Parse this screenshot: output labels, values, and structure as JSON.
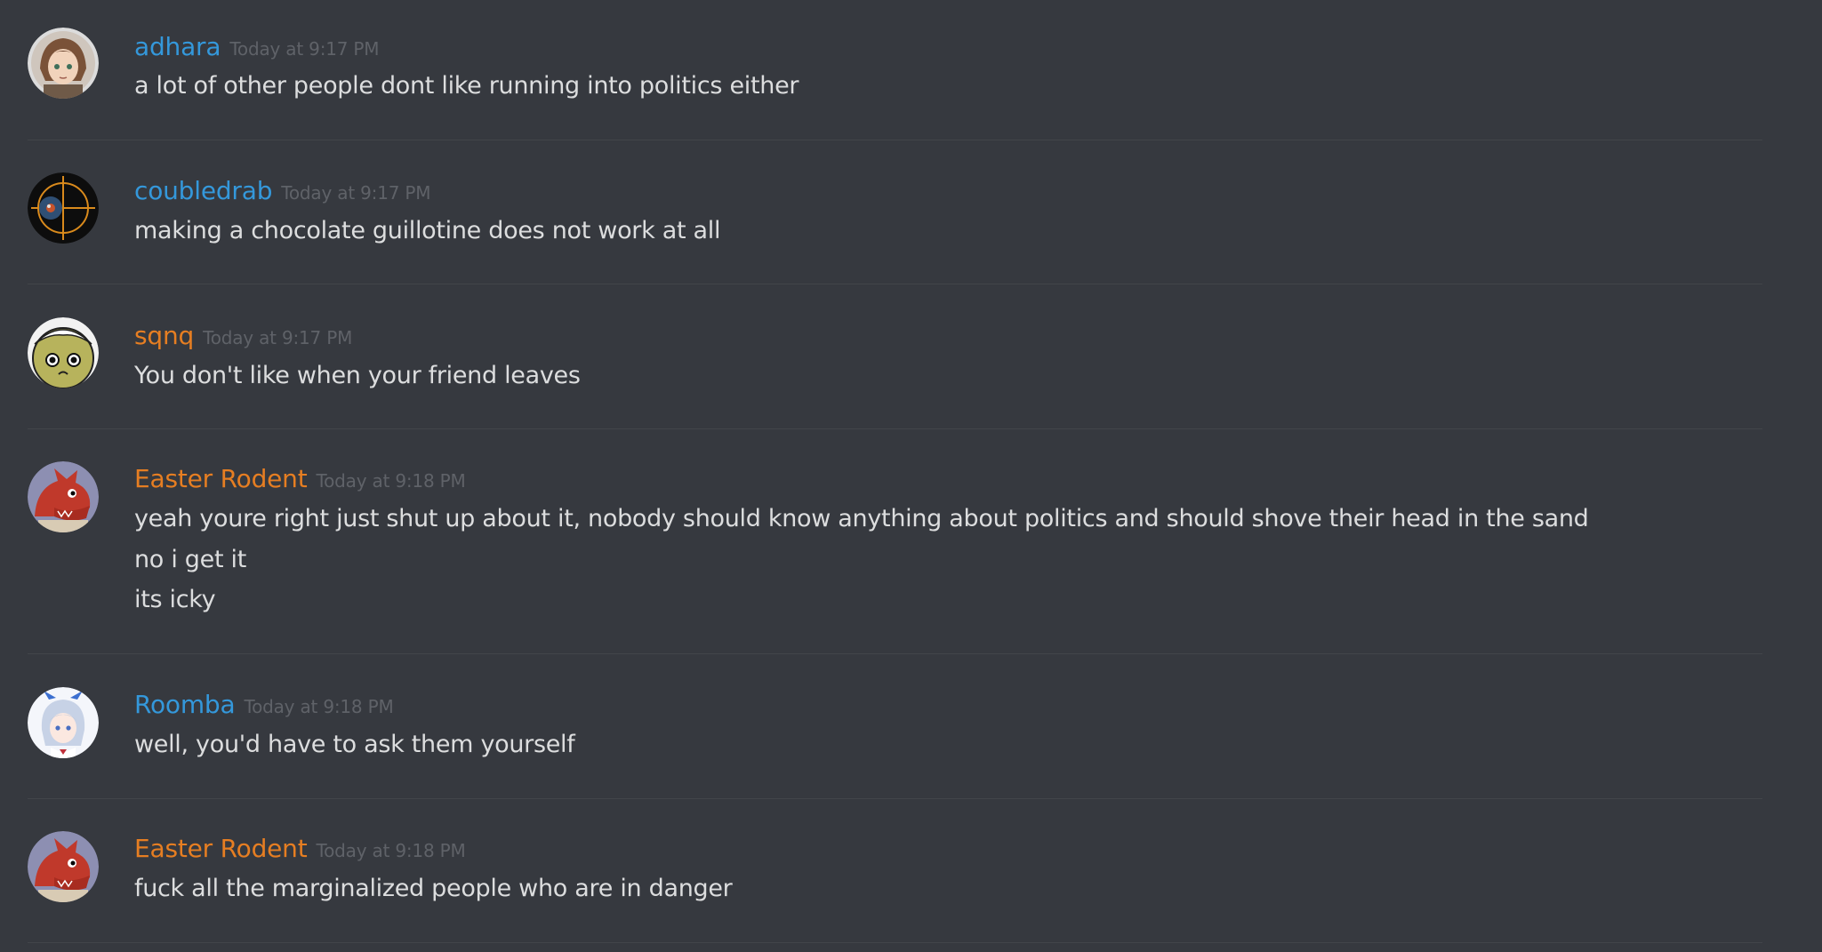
{
  "colors": {
    "background": "#36393f",
    "text": "#dcddde",
    "timestamp": "#5f6268",
    "divider": "#42454a",
    "blue_user": "#3498db",
    "orange_user": "#e67e22"
  },
  "messages": [
    {
      "username": "adhara",
      "name_color": "#3498db",
      "avatar_icon": "anime-girl-brown-hair-avatar",
      "timestamp": "Today at 9:17 PM",
      "lines": [
        "a lot of other people dont like running into politics either"
      ]
    },
    {
      "username": "coubledrab",
      "name_color": "#3498db",
      "avatar_icon": "orange-crosshair-orb-avatar",
      "timestamp": "Today at 9:17 PM",
      "lines": [
        "making a chocolate guillotine does not work at all"
      ]
    },
    {
      "username": "sqnq",
      "name_color": "#e67e22",
      "avatar_icon": "yellow-frowning-face-avatar",
      "timestamp": "Today at 9:17 PM",
      "lines": [
        "You don't like when your friend leaves"
      ]
    },
    {
      "username": "Easter Rodent",
      "name_color": "#e67e22",
      "avatar_icon": "red-dragon-avatar",
      "timestamp": "Today at 9:18 PM",
      "lines": [
        "yeah youre right just shut up about it, nobody should know anything about politics and should shove their head in the sand",
        "no i get it",
        "its icky"
      ]
    },
    {
      "username": "Roomba",
      "name_color": "#3498db",
      "avatar_icon": "anime-girl-silver-hair-avatar",
      "timestamp": "Today at 9:18 PM",
      "lines": [
        "well, you'd have to ask them yourself"
      ]
    },
    {
      "username": "Easter Rodent",
      "name_color": "#e67e22",
      "avatar_icon": "red-dragon-avatar",
      "timestamp": "Today at 9:18 PM",
      "lines": [
        "fuck all the marginalized people who are in danger"
      ]
    }
  ]
}
